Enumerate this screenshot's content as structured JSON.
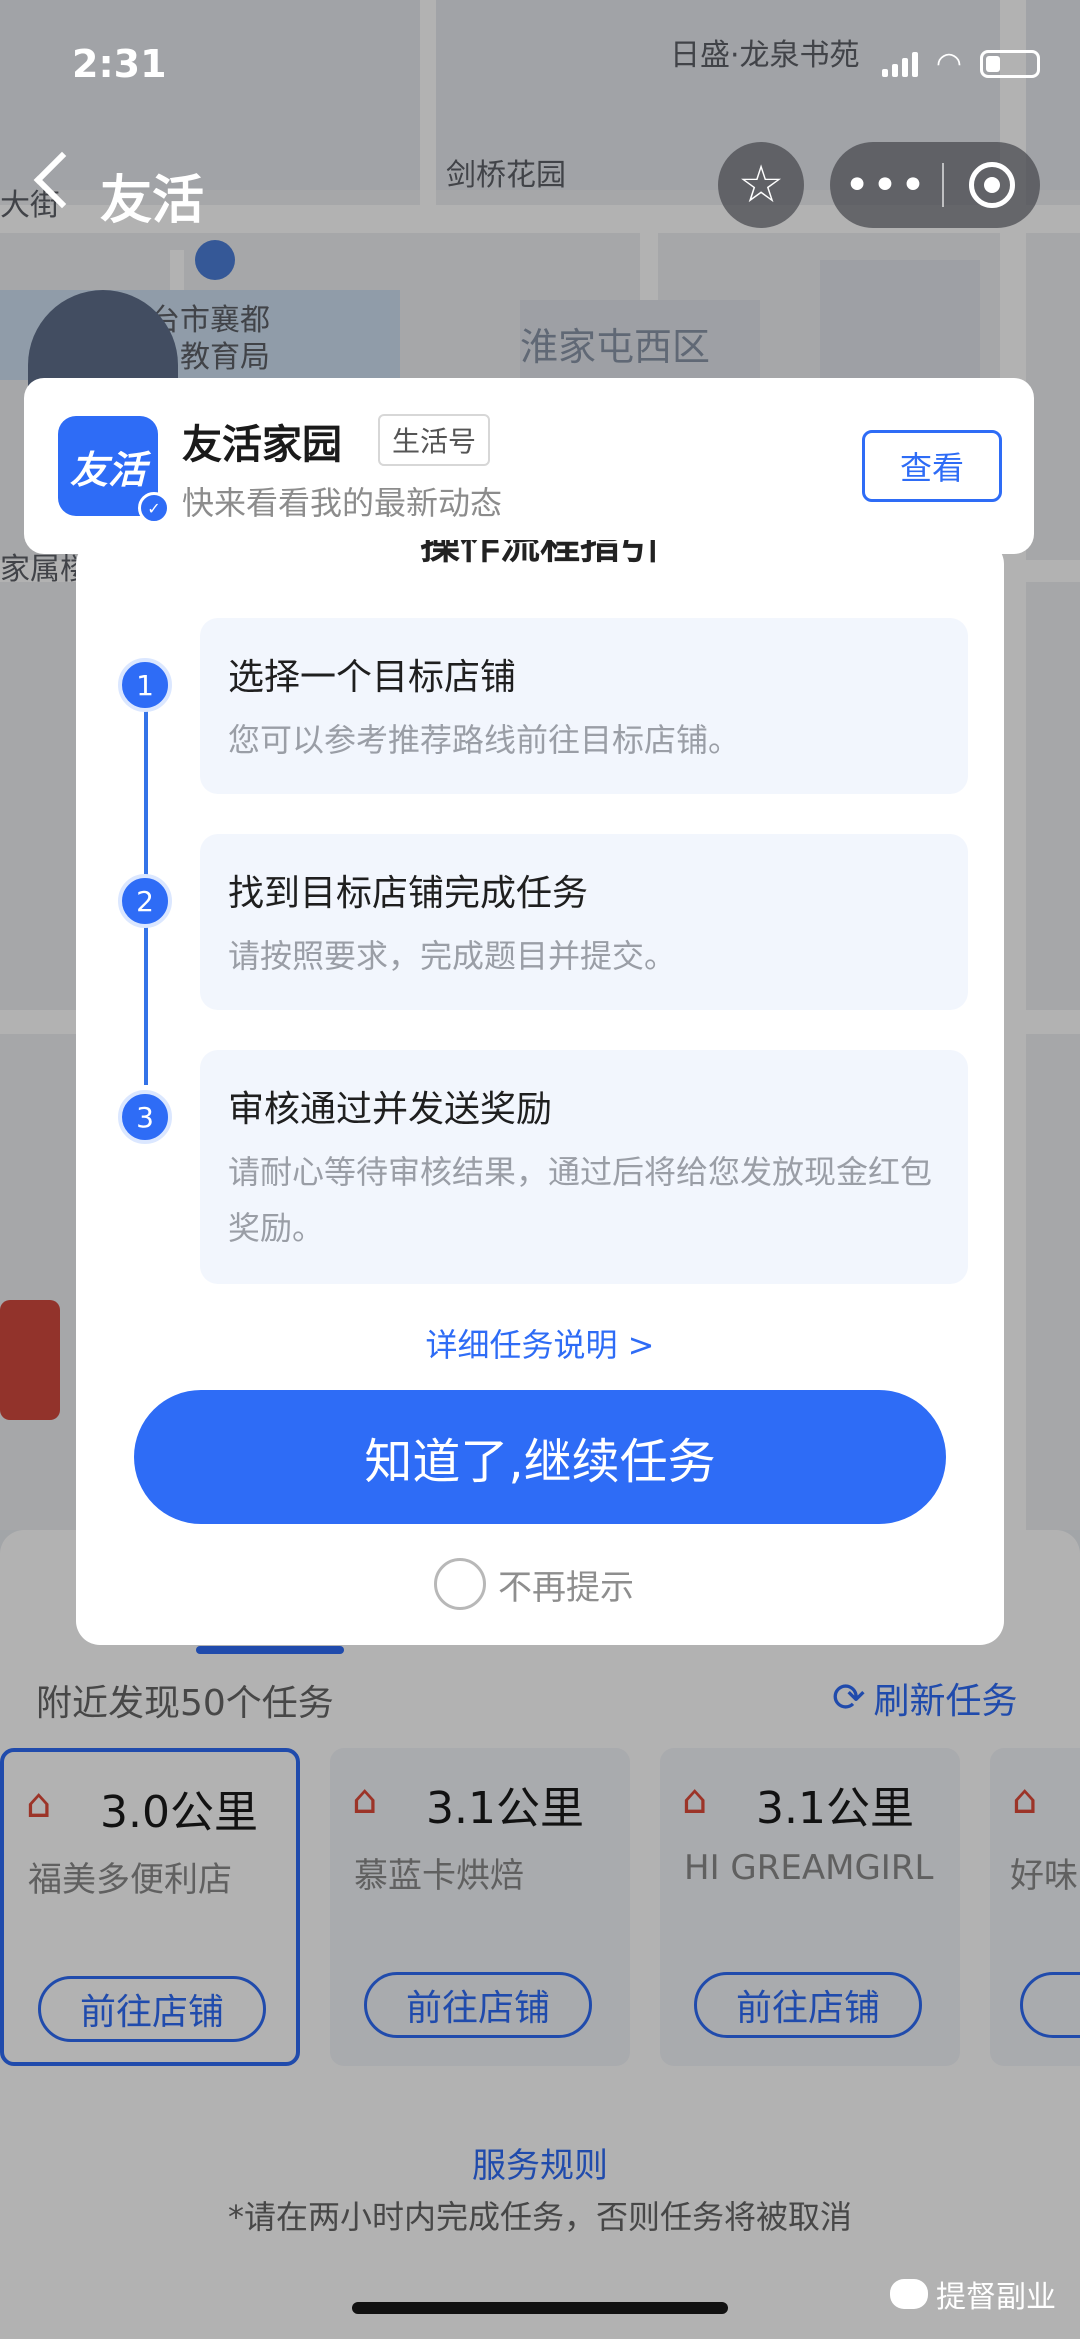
{
  "status": {
    "time": "2:31"
  },
  "map": {
    "labels": {
      "top_right": "日盛·龙泉书苑",
      "garden": "剑桥花园",
      "left_street": "大街",
      "bureau_line1": "邢台市襄都",
      "bureau_line2": "教育局",
      "district": "淮家屯西区",
      "left_home": "家属楼"
    }
  },
  "nav": {
    "title": "友活"
  },
  "banner": {
    "logo_text": "友活",
    "name": "友活家园",
    "tag": "生活号",
    "subtitle": "快来看看我的最新动态",
    "view_button": "查看"
  },
  "modal": {
    "title": "操作流程指引",
    "steps": [
      {
        "num": "1",
        "title": "选择一个目标店铺",
        "desc": "您可以参考推荐路线前往目标店铺。"
      },
      {
        "num": "2",
        "title": "找到目标店铺完成任务",
        "desc": "请按照要求，完成题目并提交。"
      },
      {
        "num": "3",
        "title": "审核通过并发送奖励",
        "desc": "请耐心等待审核结果，通过后将给您发放现金红包奖励。"
      }
    ],
    "detail_link": "详细任务说明 >",
    "confirm_button": "知道了,继续任务",
    "no_remind": "不再提示"
  },
  "panel": {
    "nearby_text": "附近发现50个任务",
    "refresh_label": "刷新任务",
    "stores": [
      {
        "distance": "3.0公里",
        "name": "福美多便利店",
        "button": "前往店铺"
      },
      {
        "distance": "3.1公里",
        "name": "慕蓝卡烘焙",
        "button": "前往店铺"
      },
      {
        "distance": "3.1公里",
        "name": "HI GREAMGIRL",
        "button": "前往店铺"
      },
      {
        "distance": "",
        "name": "好味",
        "button": "前"
      }
    ],
    "rules_link": "服务规则",
    "notice": "*请在两小时内完成任务，否则任务将被取消"
  },
  "watermark": "提督副业",
  "colors": {
    "accent": "#2e6cf6",
    "shop_icon": "#e04b3a"
  }
}
